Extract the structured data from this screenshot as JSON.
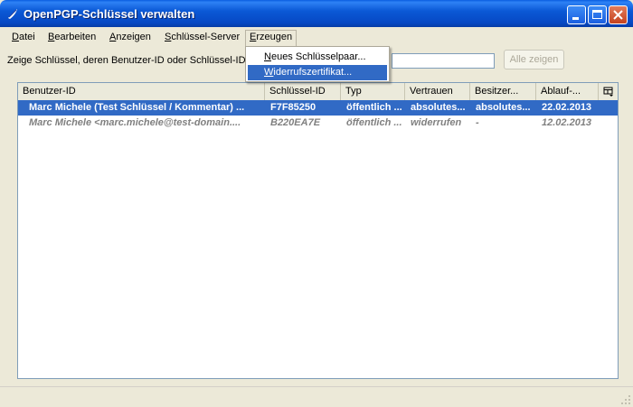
{
  "window": {
    "title": "OpenPGP-Schlüssel verwalten"
  },
  "menubar": [
    {
      "mnemonic": "D",
      "rest": "atei"
    },
    {
      "mnemonic": "B",
      "rest": "earbeiten"
    },
    {
      "mnemonic": "A",
      "rest": "nzeigen"
    },
    {
      "mnemonic": "S",
      "rest": "chlüssel-Server"
    },
    {
      "mnemonic": "E",
      "rest": "rzeugen"
    }
  ],
  "menu": {
    "item0": {
      "mnemonic": "D",
      "rest": "atei"
    },
    "item1": {
      "mnemonic": "B",
      "rest": "earbeiten"
    },
    "item2": {
      "mnemonic": "A",
      "rest": "nzeigen"
    },
    "item3": {
      "mnemonic": "S",
      "rest": "chlüssel-Server"
    },
    "item4": {
      "mnemonic": "E",
      "rest": "rzeugen"
    }
  },
  "dropdown": {
    "new_keypair": {
      "mnemonic": "N",
      "rest": "eues Schlüsselpaar..."
    },
    "revocation": {
      "mnemonic": "W",
      "rest": "iderrufszertifikat..."
    }
  },
  "filter": {
    "label": "Zeige Schlüssel, deren Benutzer-ID oder Schlüssel-ID f",
    "value": "",
    "show_all_label": "Alle zeigen"
  },
  "table": {
    "columns": {
      "user_id": "Benutzer-ID",
      "key_id": "Schlüssel-ID",
      "type": "Typ",
      "trust": "Vertrauen",
      "owner": "Besitzer...",
      "expiry": "Ablauf-..."
    },
    "rows": [
      {
        "user_id": "Marc Michele (Test Schlüssel / Kommentar) ...",
        "key_id": "F7F85250",
        "type": "öffentlich ...",
        "trust": "absolutes...",
        "owner": "absolutes...",
        "expiry": "22.02.2013",
        "state": "selected"
      },
      {
        "user_id": "Marc Michele <marc.michele@test-domain....",
        "key_id": "B220EA7E",
        "type": "öffentlich ...",
        "trust": "widerrufen",
        "owner": "-",
        "expiry": "12.02.2013",
        "state": "revoked"
      }
    ]
  },
  "colors": {
    "titlebar": "#0b59d6",
    "selection": "#316ac5",
    "revoked_text": "#808080"
  }
}
